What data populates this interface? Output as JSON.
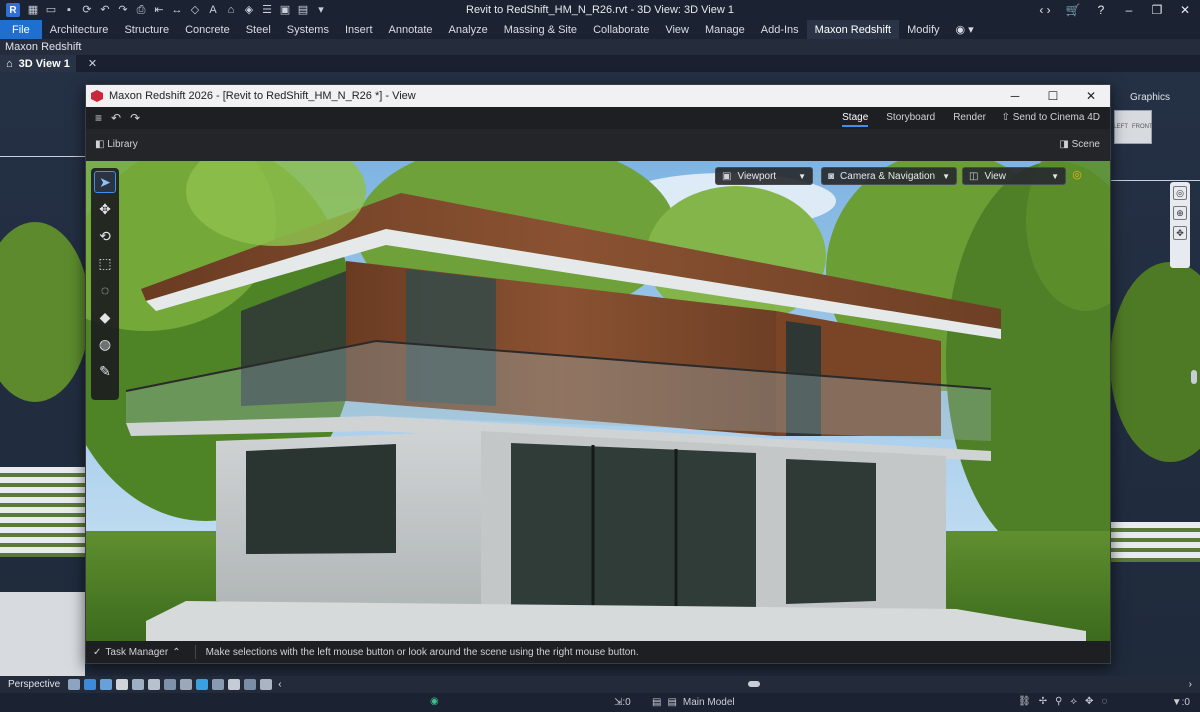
{
  "revit": {
    "window_title": "Revit to RedShift_HM_N_R26.rvt - 3D View: 3D View 1",
    "ribbon_tabs": [
      "File",
      "Architecture",
      "Structure",
      "Concrete",
      "Steel",
      "Systems",
      "Insert",
      "Annotate",
      "Analyze",
      "Massing & Site",
      "Collaborate",
      "View",
      "Manage",
      "Add-Ins",
      "Maxon Redshift",
      "Modify"
    ],
    "active_tab": "Maxon Redshift",
    "context_label": "Maxon Redshift",
    "view_tab": "3D View 1",
    "graphics_label": "Graphics",
    "viewcube_faces": [
      "LEFT",
      "FRONT"
    ],
    "view_control": {
      "mode": "Perspective"
    },
    "status": {
      "model": "Main Model",
      "worksets_count": ":0",
      "filter_count": ":0"
    },
    "colors": {
      "accent": "#1f6fd0",
      "background": "#1b2231"
    }
  },
  "redshift": {
    "title": "Maxon Redshift 2026 - [Revit to RedShift_HM_N_R26 *] - View",
    "modes": [
      "Stage",
      "Storyboard",
      "Render"
    ],
    "active_mode": "Stage",
    "send_label": "Send to Cinema 4D",
    "library_label": "Library",
    "scene_label": "Scene",
    "dropdowns": {
      "viewport": "Viewport",
      "camera": "Camera & Navigation",
      "view": "View"
    },
    "tools": [
      "select-arrow",
      "move",
      "rotate",
      "scale",
      "material-pick",
      "paint",
      "fill",
      "eyedropper"
    ],
    "task_manager": "Task Manager",
    "status_hint": "Make selections with the left mouse button or look around the scene using the right mouse button.",
    "colors": {
      "logo": "#c8283a",
      "highlight": "#3d8ff2"
    }
  }
}
